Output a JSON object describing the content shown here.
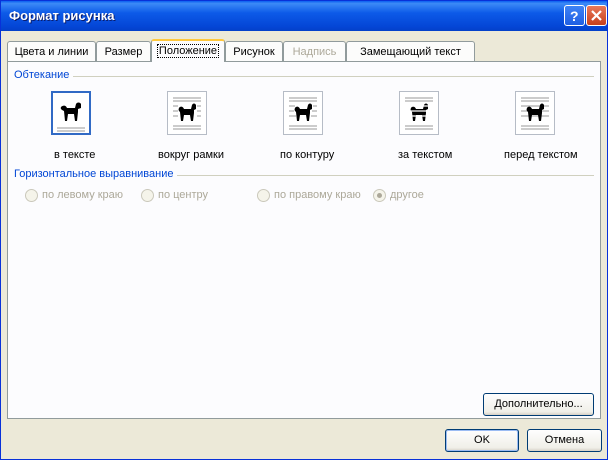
{
  "window": {
    "title": "Формат рисунка"
  },
  "tabs": [
    {
      "label": "Цвета и линии",
      "state": "normal"
    },
    {
      "label": "Размер",
      "state": "normal"
    },
    {
      "label": "Положение",
      "state": "active"
    },
    {
      "label": "Рисунок",
      "state": "normal"
    },
    {
      "label": "Надпись",
      "state": "disabled"
    },
    {
      "label": "Замещающий текст",
      "state": "normal"
    }
  ],
  "wrapping": {
    "title": "Обтекание",
    "options": [
      {
        "label": "в тексте",
        "icon": "wrap-inline-icon",
        "selected": true
      },
      {
        "label": "вокруг рамки",
        "icon": "wrap-square-icon",
        "selected": false
      },
      {
        "label": "по контуру",
        "icon": "wrap-tight-icon",
        "selected": false
      },
      {
        "label": "за текстом",
        "icon": "wrap-behind-text-icon",
        "selected": false
      },
      {
        "label": "перед текстом",
        "icon": "wrap-in-front-icon",
        "selected": false
      }
    ]
  },
  "alignment": {
    "title": "Горизонтальное выравнивание",
    "options": [
      {
        "label": "по левому краю",
        "checked": false,
        "enabled": false
      },
      {
        "label": "по центру",
        "checked": false,
        "enabled": false
      },
      {
        "label": "по правому краю",
        "checked": false,
        "enabled": false
      },
      {
        "label": "другое",
        "checked": true,
        "enabled": false
      }
    ]
  },
  "buttons": {
    "advanced": "Дополнительно...",
    "ok": "OK",
    "cancel": "Отмена"
  },
  "colors": {
    "titlebar": "#0a5ff1",
    "dialog_bg": "#ece9d8",
    "group_title": "#0046d5",
    "active_tab_accent": "#ffc83c",
    "selection_border": "#316ac5",
    "disabled_text": "#aca899"
  }
}
